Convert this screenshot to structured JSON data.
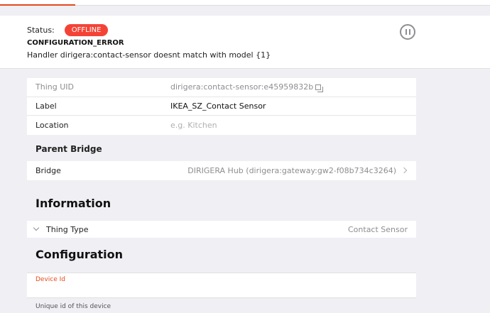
{
  "status": {
    "label": "Status:",
    "badge": "OFFLINE",
    "error_code": "CONFIGURATION_ERROR",
    "error_message": "Handler dirigera:contact-sensor doesnt match with model {1}"
  },
  "thing": {
    "uid_label": "Thing UID",
    "uid_value": "dirigera:contact-sensor:e45959832b",
    "label_label": "Label",
    "label_value": "IKEA_SZ_Contact Sensor",
    "location_label": "Location",
    "location_placeholder": "e.g. Kitchen"
  },
  "parent_bridge": {
    "title": "Parent Bridge",
    "bridge_label": "Bridge",
    "bridge_value": "DIRIGERA Hub (dirigera:gateway:gw2-f08b734c3264)"
  },
  "information": {
    "title": "Information",
    "thing_type_label": "Thing Type",
    "thing_type_value": "Contact Sensor"
  },
  "configuration": {
    "title": "Configuration",
    "device_id_label": "Device Id",
    "device_id_value": "",
    "device_id_help": "Unique id of this device"
  },
  "colors": {
    "accent": "#e64a19",
    "offline": "#f44336",
    "muted": "#8e8e93",
    "background": "#efeff4"
  }
}
